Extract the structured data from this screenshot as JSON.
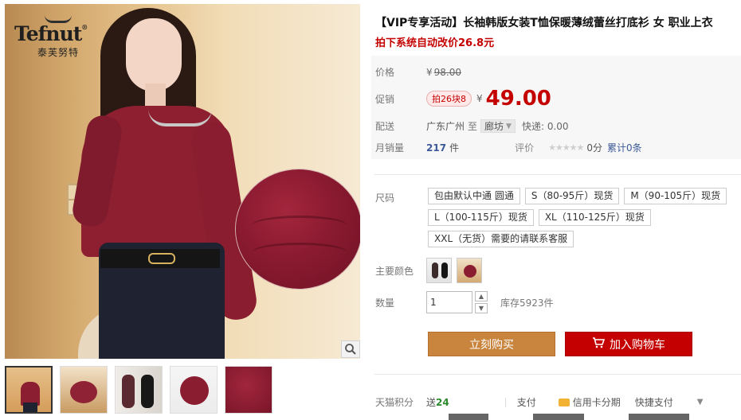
{
  "brand": {
    "name": "Tefnut",
    "registered": "®",
    "sub": "泰芙努特"
  },
  "product": {
    "title": "【VIP专享活动】长袖韩版女装T恤保暖薄绒蕾丝打底衫 女 职业上衣",
    "subtitle": "拍下系统自动改价26.8元"
  },
  "price": {
    "label": "价格",
    "currency": "¥",
    "original": "98.00"
  },
  "promo": {
    "label": "促销",
    "badge": "拍26块8",
    "currency": "¥",
    "value": "49.00"
  },
  "delivery": {
    "label": "配送",
    "from": "广东广州",
    "to_label": "至",
    "to": "廊坊",
    "shipping": "快递: 0.00"
  },
  "sales": {
    "label": "月销量",
    "value": "217",
    "unit": "件",
    "rating_label": "评价",
    "stars": "★★★★★",
    "score": "0分",
    "reviews": "累计0条"
  },
  "options": {
    "size_label": "尺码",
    "sizes": [
      "包由默认中通 圆通",
      "S（80-95斤）现货",
      "M（90-105斤）现货",
      "L（100-115斤）现货",
      "XL（110-125斤）现货",
      "XXL（无货）需要的请联系客服"
    ],
    "color_label": "主要颜色",
    "colors": [
      "color-option-1",
      "color-option-2"
    ]
  },
  "quantity": {
    "label": "数量",
    "value": "1",
    "stock": "库存5923件"
  },
  "actions": {
    "buy_now": "立刻购买",
    "add_to_cart": "加入购物车"
  },
  "footer": {
    "points_label": "天猫积分",
    "points_prefix": "送",
    "points_value": "24",
    "pay_label": "支付",
    "credit_card": "信用卡分期",
    "fast_pay": "快捷支付"
  },
  "icons": {
    "zoom": "magnifier-icon",
    "cart": "cart-icon",
    "credit_card": "credit-card-icon",
    "stepper_up": "chevron-up-icon",
    "stepper_down": "chevron-down-icon"
  },
  "colors": {
    "promo_red": "#c40000",
    "buy_orange": "#c9853e",
    "cart_red": "#c40000",
    "link_blue": "#3b5998"
  }
}
